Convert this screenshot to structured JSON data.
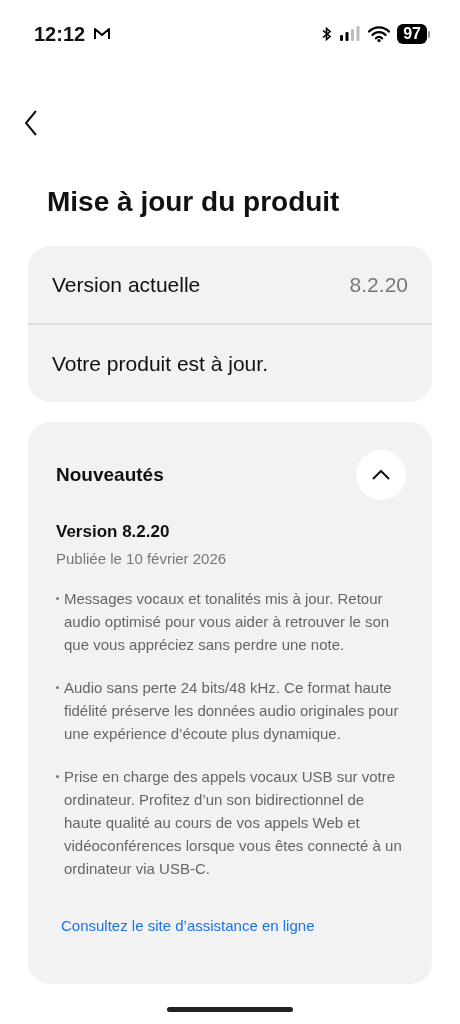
{
  "status_bar": {
    "time": "12:12",
    "battery": "97"
  },
  "title": "Mise à jour du produit",
  "version_card": {
    "label": "Version actuelle",
    "value": "8.2.20",
    "status": "Votre produit est à jour."
  },
  "release_notes": {
    "heading": "Nouveautés",
    "expanded": true,
    "version": "Version 8.2.20",
    "date": "Publiée le 10 février 2026",
    "notes": [
      "Messages vocaux et tonalités mis à jour. Retour audio optimisé pour vous aider à retrouver le son que vous appréciez sans perdre une note.",
      "Audio sans perte 24 bits/48 kHz. Ce format haute fidélité préserve les données audio originales pour une expérience d’écoute plus dynamique.",
      "Prise en charge des appels vocaux USB sur votre ordinateur. Profitez d’un son bidirectionnel de haute qualité au cours de vos appels Web et vidéoconférences lorsque vous êtes connecté à un ordinateur via USB-C."
    ],
    "link": "Consultez le site d’assistance en ligne"
  }
}
